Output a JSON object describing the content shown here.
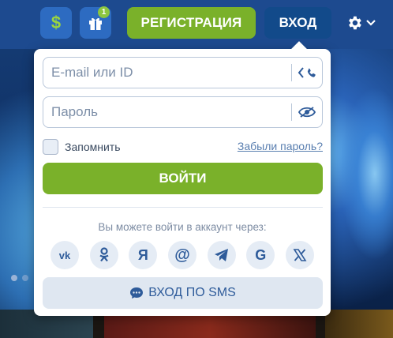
{
  "header": {
    "registration_label": "РЕГИСТРАЦИЯ",
    "login_label": "ВХОД",
    "gift_badge_count": "1",
    "dollar_symbol": "$"
  },
  "login_form": {
    "email_placeholder": "E-mail или ID",
    "password_placeholder": "Пароль",
    "remember_label": "Запомнить",
    "forgot_password_label": "Забыли пароль?",
    "submit_label": "ВОЙТИ",
    "social_prompt": "Вы можете войти в аккаунт через:",
    "social_providers": [
      {
        "icon": "vk-icon",
        "glyph": "vk"
      },
      {
        "icon": "odnoklassniki-icon",
        "glyph": "ok"
      },
      {
        "icon": "yandex-icon",
        "glyph": "Я"
      },
      {
        "icon": "mailru-icon",
        "glyph": "@"
      },
      {
        "icon": "telegram-icon",
        "glyph": "tg"
      },
      {
        "icon": "google-icon",
        "glyph": "G"
      },
      {
        "icon": "x-icon",
        "glyph": "X"
      }
    ],
    "sms_label": "ВХОД ПО SMS"
  },
  "colors": {
    "accent_green": "#7ab12a",
    "header_blue": "#1d4a8f",
    "link_blue": "#5a7fb0"
  }
}
